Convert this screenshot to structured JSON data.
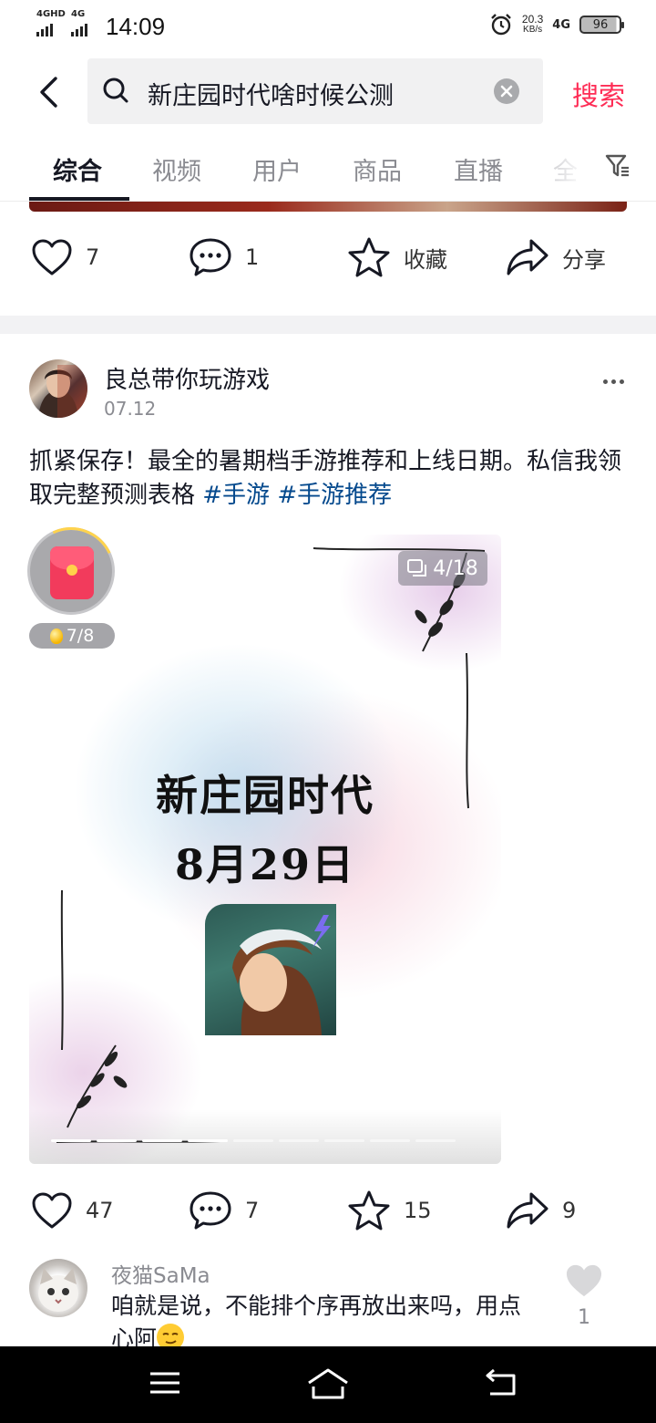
{
  "status_bar": {
    "sim1_label": "4GHD",
    "sim2_label": "4G",
    "time": "14:09",
    "net_speed_value": "20.3",
    "net_speed_unit": "KB/s",
    "network": "4G",
    "battery": "96"
  },
  "search": {
    "query": "新庄园时代啥时候公测",
    "submit_label": "搜索"
  },
  "tabs": [
    {
      "label": "综合",
      "active": true
    },
    {
      "label": "视频",
      "active": false
    },
    {
      "label": "用户",
      "active": false
    },
    {
      "label": "商品",
      "active": false
    },
    {
      "label": "直播",
      "active": false
    },
    {
      "label": "全",
      "active": false
    }
  ],
  "prev_post_actions": {
    "likes": "7",
    "comments": "1",
    "favorite_label": "收藏",
    "share_label": "分享"
  },
  "post": {
    "author": "良总带你玩游戏",
    "date": "07.12",
    "text": "抓紧保存！最全的暑期档手游推荐和上线日期。私信我领取完整预测表格 ",
    "hashtags": [
      "#手游",
      "#手游推荐"
    ],
    "media": {
      "title_line1": "新庄园时代",
      "title_line2": "8月29日",
      "counter": "4/18",
      "current_page": 4,
      "total_pages": 18
    },
    "red_packet": {
      "coin_progress": "7/8"
    },
    "actions": {
      "likes": "47",
      "comments": "7",
      "favorites": "15",
      "shares": "9"
    }
  },
  "comment": {
    "user": "夜猫SaMa",
    "text": "咱就是说，不能排个序再放出来吗，用点心阿",
    "likes": "1"
  },
  "colors": {
    "accent": "#fe2c55",
    "hashtag": "#04498d",
    "text": "#161823",
    "secondary": "#8a8b91"
  },
  "icons": [
    "back-icon",
    "search-icon",
    "clear-icon",
    "filter-icon",
    "heart-icon",
    "comment-icon",
    "star-icon",
    "share-icon",
    "more-icon",
    "gallery-icon",
    "red-packet-icon",
    "menu-icon",
    "home-icon",
    "back-nav-icon"
  ]
}
